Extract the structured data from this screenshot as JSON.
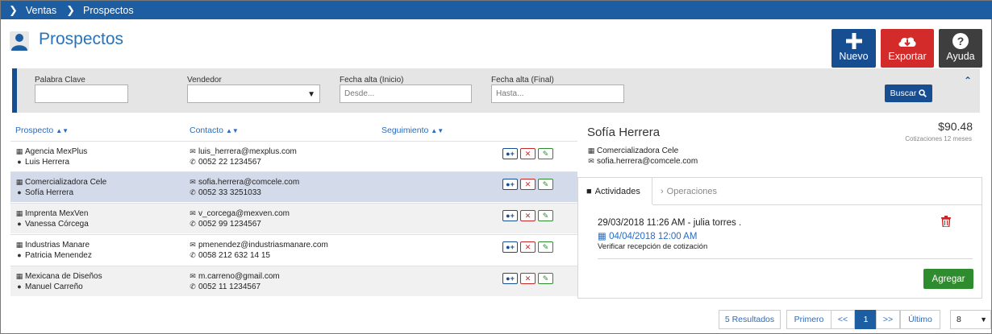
{
  "breadcrumb": [
    "Ventas",
    "Prospectos"
  ],
  "page": {
    "title": "Prospectos"
  },
  "toolbar": {
    "new_label": "Nuevo",
    "export_label": "Exportar",
    "help_label": "Ayuda"
  },
  "filters": {
    "keyword_label": "Palabra Clave",
    "seller_label": "Vendedor",
    "date_from_label": "Fecha alta (Inicio)",
    "date_from_placeholder": "Desde...",
    "date_to_label": "Fecha alta (Final)",
    "date_to_placeholder": "Hasta...",
    "search_label": "Buscar"
  },
  "table": {
    "headers": {
      "prospect": "Prospecto",
      "contact": "Contacto",
      "followup": "Seguimiento"
    },
    "rows": [
      {
        "company": "Agencia MexPlus",
        "person": "Luis Herrera",
        "email": "luis_herrera@mexplus.com",
        "phone": "0052 22 1234567"
      },
      {
        "company": "Comercializadora Cele",
        "person": "Sofía Herrera",
        "email": "sofia.herrera@comcele.com",
        "phone": "0052 33 3251033"
      },
      {
        "company": "Imprenta MexVen",
        "person": "Vanessa Córcega",
        "email": "v_corcega@mexven.com",
        "phone": "0052 99 1234567"
      },
      {
        "company": "Industrias Manare",
        "person": "Patricia Menendez",
        "email": "pmenendez@industriasmanare.com",
        "phone": "0058 212 632 14 15"
      },
      {
        "company": "Mexicana de Diseños",
        "person": "Manuel Carreño",
        "email": "m.carreno@gmail.com",
        "phone": "0052 11 1234567"
      }
    ]
  },
  "detail": {
    "name": "Sofía Herrera",
    "amount": "$90.48",
    "amount_caption": "Cotizaciones 12 meses",
    "company": "Comercializadora Cele",
    "email": "sofia.herrera@comcele.com",
    "tabs": {
      "activities": "Actividades",
      "operations": "Operaciones"
    },
    "activity": {
      "header": "29/03/2018 11:26 AM - julia torres .",
      "due": "04/04/2018 12:00 AM",
      "description": "Verificar recepción de cotización"
    },
    "add_label": "Agregar"
  },
  "pagination": {
    "results": "5 Resultados",
    "first": "Primero",
    "prev": "<<",
    "current": "1",
    "next": ">>",
    "last": "Último",
    "page_size": "8"
  },
  "colors": {
    "primary": "#174e91",
    "danger": "#d32a2a",
    "success": "#2e8b2e",
    "dark": "#3e3e3e"
  }
}
